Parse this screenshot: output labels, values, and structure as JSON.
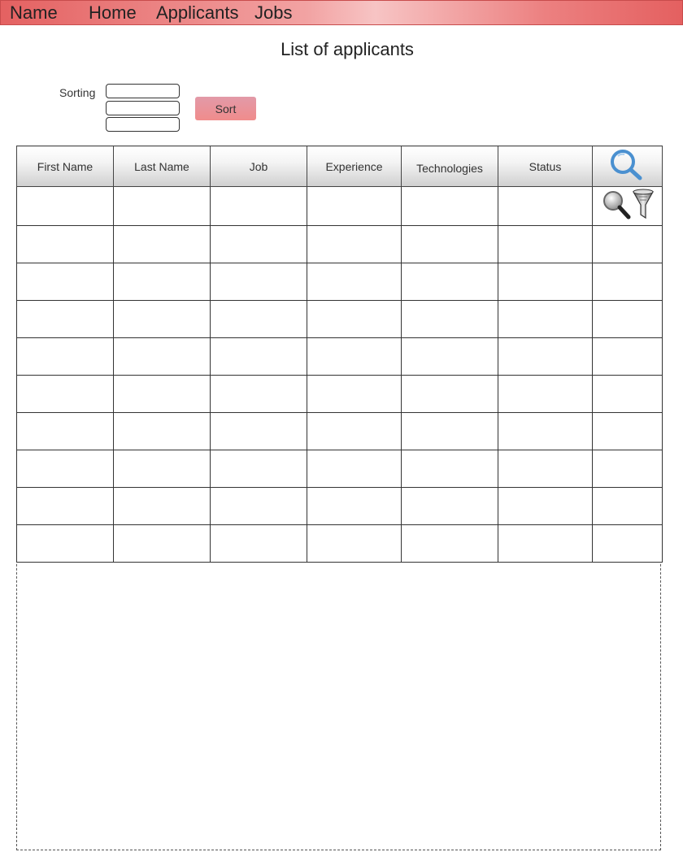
{
  "nav": {
    "brand": "Name",
    "items": [
      "Home",
      "Applicants",
      "Jobs"
    ]
  },
  "page": {
    "title": "List of applicants"
  },
  "sorting": {
    "label": "Sorting",
    "fields": [
      "",
      "",
      ""
    ],
    "button_label": "Sort"
  },
  "table": {
    "columns": [
      "First Name",
      "Last Name",
      "Job",
      "Experience",
      "Technologies",
      "Status"
    ],
    "actions_header_icon": "search-icon",
    "row_action_icons": [
      "magnifier-icon",
      "filter-icon"
    ],
    "rows": [
      [
        "",
        "",
        "",
        "",
        "",
        "",
        ""
      ],
      [
        "",
        "",
        "",
        "",
        "",
        "",
        ""
      ],
      [
        "",
        "",
        "",
        "",
        "",
        "",
        ""
      ],
      [
        "",
        "",
        "",
        "",
        "",
        "",
        ""
      ],
      [
        "",
        "",
        "",
        "",
        "",
        "",
        ""
      ],
      [
        "",
        "",
        "",
        "",
        "",
        "",
        ""
      ],
      [
        "",
        "",
        "",
        "",
        "",
        "",
        ""
      ],
      [
        "",
        "",
        "",
        "",
        "",
        "",
        ""
      ],
      [
        "",
        "",
        "",
        "",
        "",
        "",
        ""
      ],
      [
        "",
        "",
        "",
        "",
        "",
        "",
        ""
      ]
    ]
  },
  "colors": {
    "nav_bar": "#e46161",
    "sort_button": "#f08c8c",
    "search_icon": "#4a90d0"
  }
}
